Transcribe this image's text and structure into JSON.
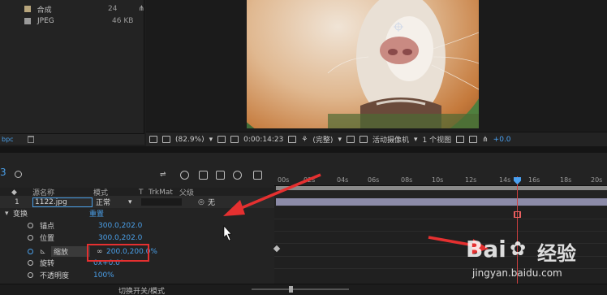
{
  "project": {
    "rows": [
      {
        "name": "合成",
        "count": "24",
        "color": "#b7a57c"
      },
      {
        "name": "JPEG",
        "count": "46 KB",
        "color": "#9a9a9a"
      }
    ],
    "bpc_label": "bpc"
  },
  "viewer": {
    "zoom": "(82.9%)",
    "timecode": "0:00:14:23",
    "quality": "(完整)",
    "camera": "活动摄像机",
    "views": "1 个视图",
    "exposure": "+0.0"
  },
  "timeline": {
    "comp_number": "3",
    "columns": {
      "source_name": "源名称",
      "mode": "模式",
      "t": "T",
      "trkmat": "TrkMat",
      "parent": "父级"
    },
    "layer": {
      "index": "1",
      "name": "1122.jpg",
      "mode": "正常",
      "parent": "无"
    },
    "transform": {
      "label": "变换",
      "reset": "重置",
      "props": [
        {
          "label": "锚点",
          "value": "300.0,202.0"
        },
        {
          "label": "位置",
          "value": "300.0,202.0"
        },
        {
          "label": "缩放",
          "value": "200.0,200.0%"
        },
        {
          "label": "旋转",
          "value": "0x+0.0°"
        },
        {
          "label": "不透明度",
          "value": "100%"
        }
      ]
    },
    "ruler_ticks": [
      "00s",
      "02s",
      "04s",
      "06s",
      "08s",
      "10s",
      "12s",
      "14s",
      "16s",
      "18s",
      "20s"
    ],
    "footer": "切换开关/模式"
  },
  "watermark": {
    "brand": "Bai",
    "brand2": "经验",
    "url": "jingyan.baidu.com"
  },
  "colors": {
    "accent": "#4a9fe8",
    "playhead": "#d04040",
    "annotation": "#e53030"
  }
}
